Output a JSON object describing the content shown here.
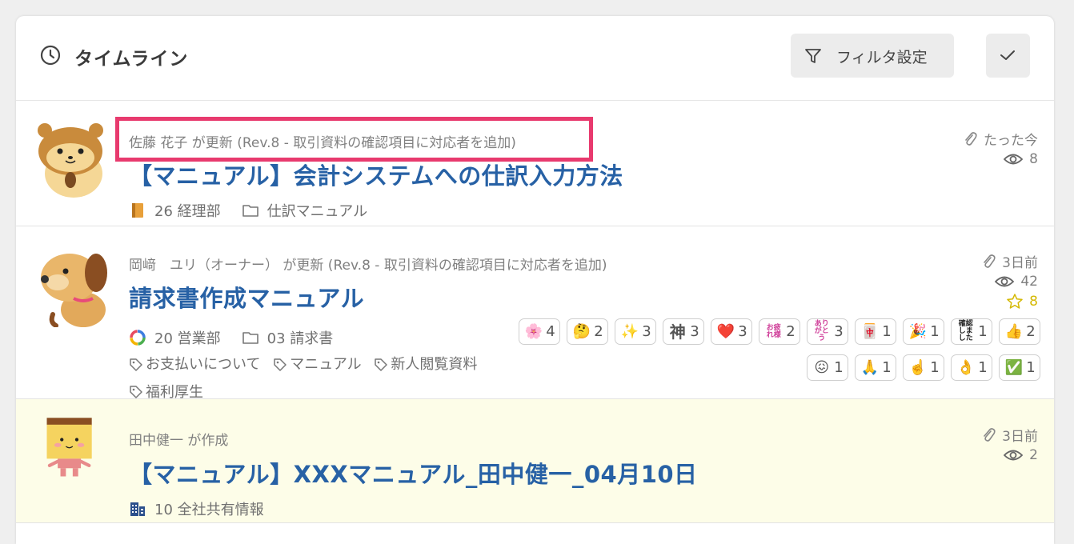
{
  "header": {
    "title": "タイムライン",
    "filter_label": "フィルタ設定"
  },
  "items": [
    {
      "meta": "佐藤 花子 が更新 (Rev.8 - 取引資料の確認項目に対応者を追加)",
      "title": "【マニュアル】会計システムへの仕訳入力方法",
      "space": "26 経理部",
      "folder": "仕訳マニュアル",
      "time": "たった今",
      "views": "8"
    },
    {
      "meta": "岡﨑　ユリ（オーナー） が更新 (Rev.8 - 取引資料の確認項目に対応者を追加)",
      "title": "請求書作成マニュアル",
      "space": "20 営業部",
      "folder": "03 請求書",
      "tags": [
        "お支払いについて",
        "マニュアル",
        "新人閲覧資料",
        "福利厚生"
      ],
      "time": "3日前",
      "views": "42",
      "stars": "8",
      "reactions_row1": [
        {
          "icon": "🌸",
          "count": "4"
        },
        {
          "icon": "🤔",
          "count": "2"
        },
        {
          "icon": "✨",
          "count": "3"
        },
        {
          "icon": "神",
          "count": "3"
        },
        {
          "icon": "❤️",
          "count": "3"
        },
        {
          "icon": "お疲れ様",
          "count": "2"
        },
        {
          "icon": "ありがとう",
          "count": "3"
        },
        {
          "icon": "🀄",
          "count": "1"
        },
        {
          "icon": "🎉",
          "count": "1"
        },
        {
          "icon": "確認しました",
          "count": "1"
        },
        {
          "icon": "👍",
          "count": "2"
        }
      ],
      "reactions_row2": [
        {
          "icon": "😖",
          "count": "1"
        },
        {
          "icon": "🙏",
          "count": "1"
        },
        {
          "icon": "☝️",
          "count": "1"
        },
        {
          "icon": "👌",
          "count": "1"
        },
        {
          "icon": "✅",
          "count": "1"
        }
      ]
    },
    {
      "meta": "田中健一 が作成",
      "title": "【マニュアル】XXXマニュアル_田中健一_04月10日",
      "space": "10 全社共有情報",
      "time": "3日前",
      "views": "2"
    }
  ],
  "colors": {
    "title_blue": "#2761a5",
    "highlight": "#e83a6e",
    "star": "#d4b800",
    "new_item_bg": "#fdfde8"
  }
}
